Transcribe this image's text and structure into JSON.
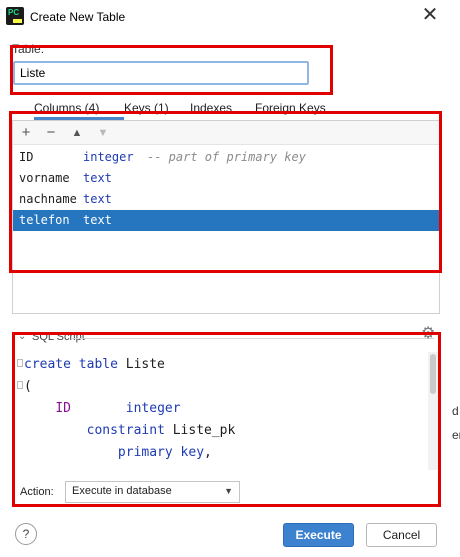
{
  "window": {
    "title": "Create New Table",
    "app_icon_text": "PC",
    "close_glyph": "✕"
  },
  "table_section": {
    "label": "Table:",
    "name_value": "Liste"
  },
  "tabs": [
    {
      "label": "Columns (4)",
      "active": true
    },
    {
      "label": "Keys (1)",
      "active": false
    },
    {
      "label": "Indexes",
      "active": false
    },
    {
      "label": "Foreign Keys",
      "active": false
    }
  ],
  "toolbar": {
    "add": "+",
    "remove": "−",
    "move_up": "▲",
    "move_down": "▼"
  },
  "columns": [
    {
      "name": "ID",
      "type": "integer",
      "comment": "-- part of primary key",
      "selected": false
    },
    {
      "name": "vorname",
      "type": "text",
      "comment": "",
      "selected": false
    },
    {
      "name": "nachname",
      "type": "text",
      "comment": "",
      "selected": false
    },
    {
      "name": "telefon",
      "type": "text",
      "comment": "",
      "selected": true
    }
  ],
  "sql_script": {
    "title": "SQL Script",
    "lines": [
      {
        "parts": [
          {
            "text": "create table ",
            "cls": "kw"
          },
          {
            "text": "Liste",
            "cls": ""
          }
        ]
      },
      {
        "parts": [
          {
            "text": "(",
            "cls": ""
          }
        ]
      },
      {
        "parts": [
          {
            "text": "    ",
            "cls": ""
          },
          {
            "text": "ID",
            "cls": "id"
          },
          {
            "text": "       ",
            "cls": ""
          },
          {
            "text": "integer",
            "cls": "kw"
          }
        ]
      },
      {
        "parts": [
          {
            "text": "        ",
            "cls": ""
          },
          {
            "text": "constraint ",
            "cls": "kw"
          },
          {
            "text": "Liste_pk",
            "cls": ""
          }
        ]
      },
      {
        "parts": [
          {
            "text": "            ",
            "cls": ""
          },
          {
            "text": "primary key",
            "cls": "kw"
          },
          {
            "text": ",",
            "cls": ""
          }
        ]
      }
    ]
  },
  "action": {
    "label": "Action:",
    "selected": "Execute in database",
    "arrow": "▼"
  },
  "buttons": {
    "help": "?",
    "execute": "Execute",
    "cancel": "Cancel"
  },
  "edge_text": [
    "d",
    "er"
  ],
  "colors": {
    "annotation": "#e00000",
    "selection": "#2675bf",
    "execute_button": "#3d82cf",
    "keyword": "#1f3bb3",
    "identifier": "#871094"
  }
}
